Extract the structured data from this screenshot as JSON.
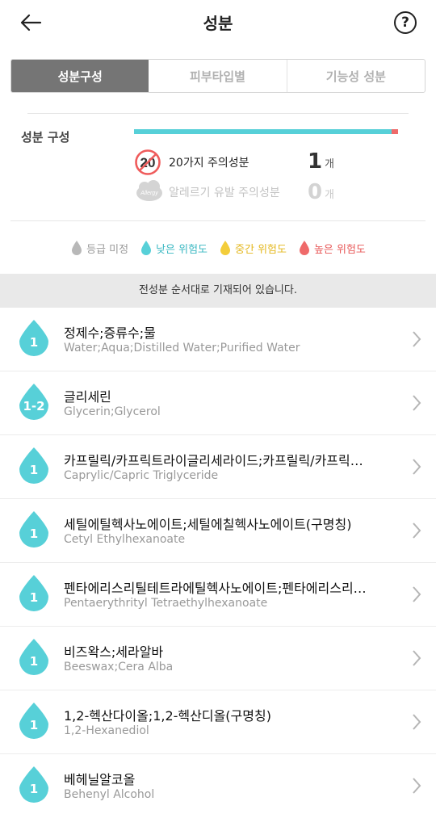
{
  "header": {
    "title": "성분",
    "help": "?"
  },
  "tabs": [
    {
      "label": "성분구성",
      "active": true
    },
    {
      "label": "피부타입별",
      "active": false
    },
    {
      "label": "기능성 성분",
      "active": false
    }
  ],
  "composition": {
    "label": "성분 구성",
    "bar_colors": {
      "low": "#57d0d8",
      "high": "#ef6a6a"
    },
    "high_fraction": 0.025,
    "caution20": {
      "badge": "20",
      "text": "20가지 주의성분",
      "count": "1",
      "unit": "개"
    },
    "allergy": {
      "badge": "Allergy",
      "text": "알레르기 유발 주의성분",
      "count": "0",
      "unit": "개"
    }
  },
  "legend": [
    {
      "label": "등급 미정",
      "color": "#b8b8b8"
    },
    {
      "label": "낮은 위험도",
      "color": "#57d0d8"
    },
    {
      "label": "중간 위험도",
      "color": "#f3cd3a"
    },
    {
      "label": "높은 위험도",
      "color": "#ef6a6a"
    }
  ],
  "notice": "전성분 순서대로 기재되어 있습니다.",
  "ingredients": [
    {
      "grade": "1",
      "name": "정제수;증류수;물",
      "english": "Water;Aqua;Distilled Water;Purified Water"
    },
    {
      "grade": "1-2",
      "name": "글리세린",
      "english": "Glycerin;Glycerol"
    },
    {
      "grade": "1",
      "name": "카프릴릭/카프릭트라이글리세라이드;카프릴릭/카프릭트라이글리세라이드",
      "english": "Caprylic/Capric Triglyceride"
    },
    {
      "grade": "1",
      "name": "세틸에틸헥사노에이트;세틸에칠헥사노에이트(구명칭)",
      "english": "Cetyl Ethylhexanoate"
    },
    {
      "grade": "1",
      "name": "펜타에리스리틸테트라에틸헥사노에이트;펜타에리스리틸테트라에칠헥사노에이트",
      "english": "Pentaerythrityl Tetraethylhexanoate"
    },
    {
      "grade": "1",
      "name": "비즈왁스;세라알바",
      "english": "Beeswax;Cera Alba"
    },
    {
      "grade": "1",
      "name": "1,2-헥산다이올;1,2-헥산디올(구명칭)",
      "english": "1,2-Hexanediol"
    },
    {
      "grade": "1",
      "name": "베헤닐알코올",
      "english": "Behenyl Alcohol"
    }
  ]
}
